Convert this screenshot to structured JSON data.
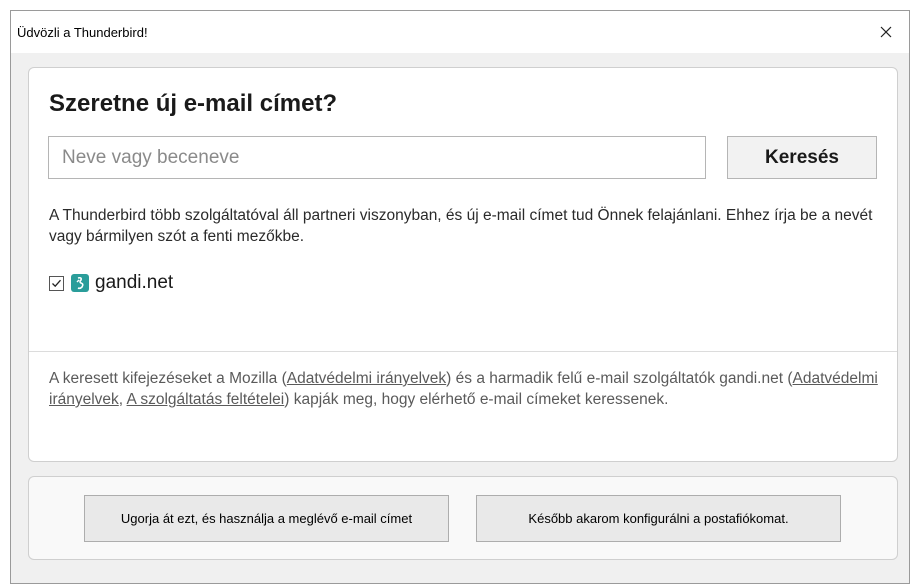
{
  "window": {
    "title": "Üdvözli a Thunderbird!",
    "close_icon": "close-icon"
  },
  "main": {
    "heading": "Szeretne új e-mail címet?",
    "search": {
      "placeholder": "Neve vagy beceneve",
      "value": "",
      "button_label": "Keresés"
    },
    "description": "A Thunderbird több szolgáltatóval áll partneri viszonyban, és új e-mail címet tud Önnek felajánlani. Ehhez írja be a nevét vagy bármilyen szót a fenti mezőkbe.",
    "providers": [
      {
        "name": "gandi.net",
        "checked": true,
        "icon": "gandi-logo-icon"
      }
    ],
    "privacy": {
      "text_1": "A keresett kifejezéseket a Mozilla (",
      "link_1": "Adatvédelmi irányelvek",
      "text_2": ") és a harmadik felű e-mail szolgáltatók gandi.net (",
      "link_2": "Adatvédelmi irányelvek",
      "text_3": ", ",
      "link_3": "A szolgáltatás feltételei",
      "text_4": ") kapják meg, hogy elérhető e-mail címeket keressenek."
    }
  },
  "footer": {
    "skip_button": "Ugorja át ezt, és használja a meglévő e-mail címet",
    "later_button": "Később akarom konfigurálni a postafiókomat."
  },
  "colors": {
    "accent": "#2a9d9a",
    "background": "#f0f0f0"
  }
}
